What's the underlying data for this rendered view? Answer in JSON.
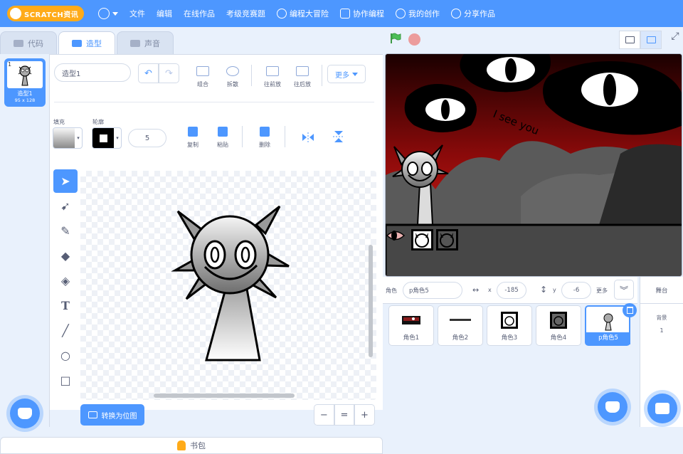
{
  "topbar": {
    "logo_text": "SCRATCH资讯",
    "menu": [
      "文件",
      "编辑",
      "在线作品",
      "考级竞赛题",
      "编程大冒险",
      "协作编程",
      "我的创作",
      "分享作品"
    ]
  },
  "tabs": [
    {
      "label": "代码",
      "active": false
    },
    {
      "label": "造型",
      "active": true
    },
    {
      "label": "声音",
      "active": false
    }
  ],
  "costume_list": {
    "number": "1",
    "name": "造型1",
    "size": "95 x 128"
  },
  "paint": {
    "costume_name": "造型1",
    "tools_top": [
      "组合",
      "拆散",
      "往前放",
      "往后放"
    ],
    "more_label": "更多",
    "fill_label": "填充",
    "outline_label": "轮廓",
    "outline_width": "5",
    "actions": [
      "复制",
      "粘贴",
      "删除"
    ],
    "convert_label": "转换为位图",
    "zoom": [
      "−",
      "=",
      "+"
    ]
  },
  "backpack_label": "书包",
  "stage_text": "I see you",
  "sprite_info": {
    "sprite_label": "角色",
    "sprite_name": "p角色5",
    "x_label": "x",
    "x_value": "-185",
    "y_label": "y",
    "y_value": "-6",
    "more_label": "更多"
  },
  "sprites": [
    {
      "name": "角色1",
      "selected": false
    },
    {
      "name": "角色2",
      "selected": false
    },
    {
      "name": "角色3",
      "selected": false
    },
    {
      "name": "角色4",
      "selected": false
    },
    {
      "name": "p角色5",
      "selected": true
    }
  ],
  "stage_panel": {
    "title": "舞台",
    "backdrop_label": "背景",
    "backdrop_count": "1"
  },
  "colors": {
    "accent": "#4d97ff",
    "orange": "#ffab19",
    "green_flag": "#4cbf56"
  }
}
